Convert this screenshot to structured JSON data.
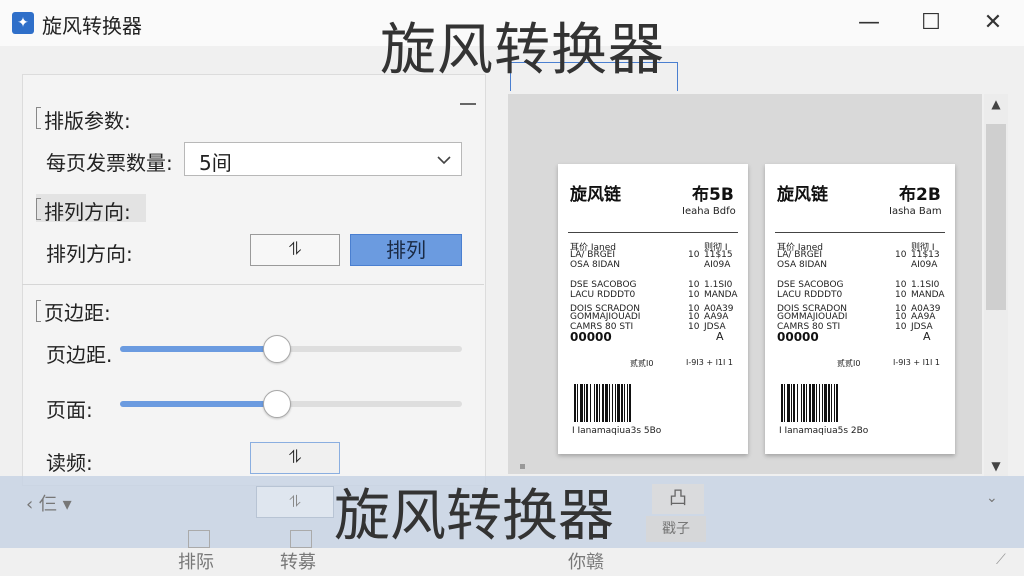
{
  "window": {
    "title": "旋风转换器",
    "overlay_title": "旋风转换器",
    "minimize": "—",
    "maximize": "☐",
    "close": "✕"
  },
  "layout_panel": {
    "section_title": "排版参数:",
    "count_label": "每页发票数量:",
    "count_value": "5间",
    "direction_section": "排列方向:",
    "direction_label": "排列方向:",
    "direction_btn_1": "⥮",
    "direction_btn_2": "排列",
    "margin_section": "页边距:",
    "margin_label": "页边距.",
    "margin_level": 0.46,
    "page_label": "页面:",
    "page_level": 0.46,
    "freq_label": "读频:",
    "freq_btn": "⥮"
  },
  "receipts": [
    {
      "title": "旋风链",
      "number": "布5B",
      "sub": "Ieaha Bdfo",
      "rows": [
        {
          "a": "耳价 Ianed",
          "b": "",
          "c": "则彻 I"
        },
        {
          "a": "LA/ BRGEI",
          "b": "10",
          "c": "11$15"
        },
        {
          "a": "OSA 8IDAN",
          "b": "",
          "c": "AI09A"
        },
        {
          "a": "DSE SACOBOG",
          "b": "10",
          "c": "1.1SI0"
        },
        {
          "a": "LACU RDDDT0",
          "b": "10",
          "c": "MANDA"
        },
        {
          "a": "DOIS SCRADON",
          "b": "10",
          "c": "A0A39"
        },
        {
          "a": "GOMMAJIOUADI",
          "b": "10",
          "c": "AA9A"
        },
        {
          "a": "CAMRS 80 STI",
          "b": "10",
          "c": "JDSA"
        }
      ],
      "total": "00000",
      "total_right": "A",
      "foot_left": "贰贰I0",
      "foot_right": "I-9I3 + I1I 1",
      "code": "I Ianamaqiua3s 5Bo"
    },
    {
      "title": "旋风链",
      "number": "布2B",
      "sub": "Iasha Bam",
      "rows": [
        {
          "a": "耳价 Ianed",
          "b": "",
          "c": "则彻 I"
        },
        {
          "a": "LA/ BRGEI",
          "b": "10",
          "c": "11$13"
        },
        {
          "a": "OSA 8IDAN",
          "b": "",
          "c": "AI09A"
        },
        {
          "a": "DSE SACOBOG",
          "b": "10",
          "c": "1.1SI0"
        },
        {
          "a": "LACU RDDDT0",
          "b": "10",
          "c": "MANDA"
        },
        {
          "a": "DOIS SCRADON",
          "b": "10",
          "c": "A0A39"
        },
        {
          "a": "GOMMAJIOUADI",
          "b": "10",
          "c": "AA9A"
        },
        {
          "a": "CAMRS 80 STI",
          "b": "10",
          "c": "JDSA"
        }
      ],
      "total": "00000",
      "total_right": "A",
      "foot_left": "贰贰I0",
      "foot_right": "I-9I3 + I1I 1",
      "code": "I Ianamaqiua5s 2Bo"
    }
  ],
  "bottom": {
    "overlay_title": "旋风转换器",
    "left_tool": "‹ 仨 ▾",
    "left_btn": "⥮",
    "right_btn": "凸",
    "right_btn2": "戳子",
    "chevron": "⌄",
    "footer_1": "排际",
    "footer_2": "转募",
    "footer_3": "你赣",
    "footer_arrow": "⟋"
  }
}
